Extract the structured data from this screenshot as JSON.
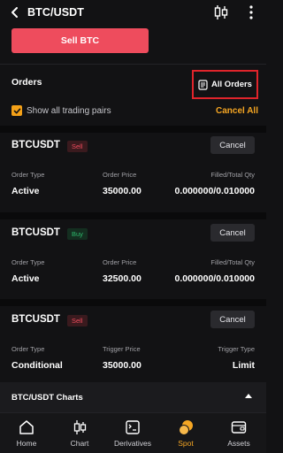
{
  "header": {
    "pair": "BTC/USDT",
    "back_icon": "chevron-left-icon",
    "kline_icon": "candlestick-icon",
    "more_icon": "more-vertical-icon"
  },
  "trade": {
    "sell_label": "Sell BTC",
    "sell_color": "#ee4c5d"
  },
  "orders": {
    "title": "Orders",
    "all_orders_label": "All Orders",
    "show_all_label": "Show all trading pairs",
    "show_all_checked": true,
    "cancel_all_label": "Cancel All",
    "items": [
      {
        "symbol": "BTCUSDT",
        "side": "Sell",
        "cancel_label": "Cancel",
        "col1_label": "Order Type",
        "col1_value": "Active",
        "col2_label": "Order Price",
        "col2_value": "35000.00",
        "col3_label": "Filled/Total Qty",
        "col3_value": "0.000000/0.010000"
      },
      {
        "symbol": "BTCUSDT",
        "side": "Buy",
        "cancel_label": "Cancel",
        "col1_label": "Order Type",
        "col1_value": "Active",
        "col2_label": "Order Price",
        "col2_value": "32500.00",
        "col3_label": "Filled/Total Qty",
        "col3_value": "0.000000/0.010000"
      },
      {
        "symbol": "BTCUSDT",
        "side": "Sell",
        "cancel_label": "Cancel",
        "col1_label": "Order Type",
        "col1_value": "Conditional",
        "col2_label": "Trigger Price",
        "col2_value": "35000.00",
        "col3_label": "Trigger Type",
        "col3_value": "Limit"
      }
    ]
  },
  "charts": {
    "title": "BTC/USDT Charts"
  },
  "tabbar": {
    "active": "Spot",
    "accent": "#f5a623",
    "tabs": [
      {
        "label": "Home",
        "icon": "home-icon"
      },
      {
        "label": "Chart",
        "icon": "candlestick-icon"
      },
      {
        "label": "Derivatives",
        "icon": "derivatives-icon"
      },
      {
        "label": "Spot",
        "icon": "spot-coins-icon"
      },
      {
        "label": "Assets",
        "icon": "wallet-icon"
      }
    ]
  }
}
